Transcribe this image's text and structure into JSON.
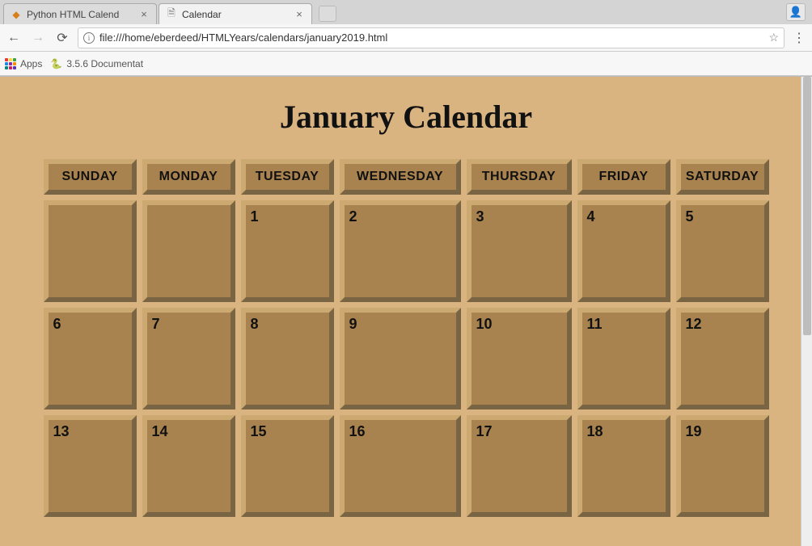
{
  "browser": {
    "tabs": [
      {
        "title": "Python HTML Calend",
        "favicon": "◆",
        "favicon_color": "#d97f1a"
      },
      {
        "title": "Calendar",
        "favicon": "🗎",
        "favicon_color": "#777"
      }
    ],
    "active_tab_index": 1,
    "url": "file:///home/eberdeed/HTMLYears/calendars/january2019.html",
    "bookmarks_bar": {
      "apps_label": "Apps",
      "items": [
        {
          "label": "3.5.6 Documentat",
          "favicon": "🐍"
        }
      ]
    }
  },
  "page": {
    "title": "January Calendar",
    "day_headers": [
      "SUNDAY",
      "MONDAY",
      "TUESDAY",
      "WEDNESDAY",
      "THURSDAY",
      "FRIDAY",
      "SATURDAY"
    ],
    "grid": [
      [
        "",
        "",
        "1",
        "2",
        "3",
        "4",
        "5"
      ],
      [
        "6",
        "7",
        "8",
        "9",
        "10",
        "11",
        "12"
      ],
      [
        "13",
        "14",
        "15",
        "16",
        "17",
        "18",
        "19"
      ]
    ]
  }
}
